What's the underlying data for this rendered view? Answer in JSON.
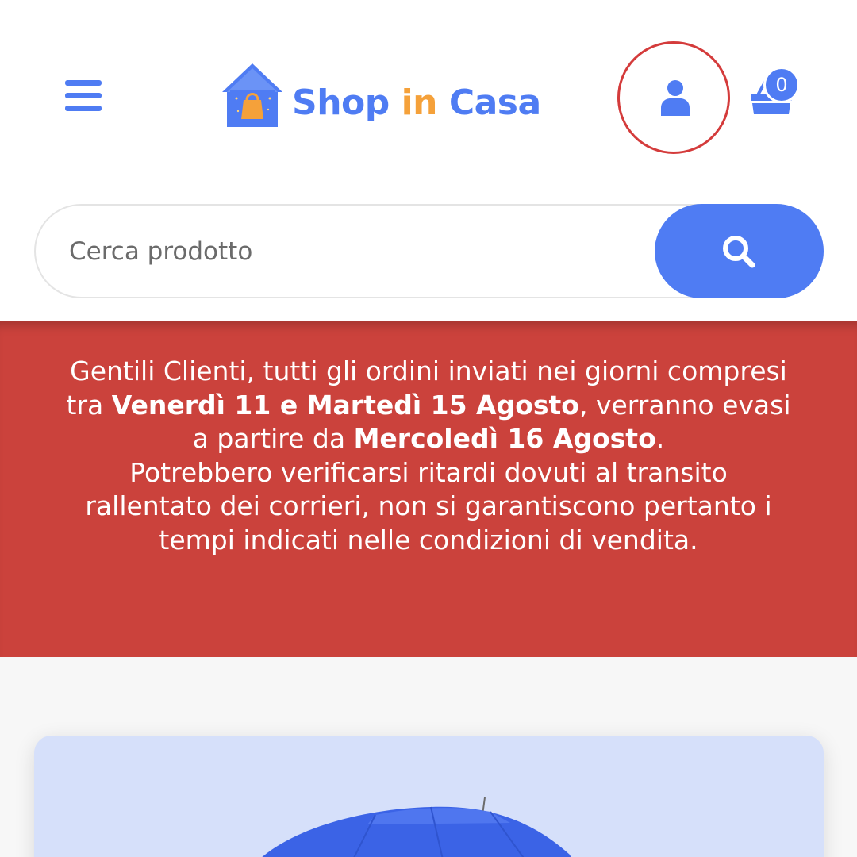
{
  "header": {
    "logo": {
      "word1": "Shop",
      "word2": "in",
      "word3": "Casa"
    },
    "menu_icon": "hamburger-menu-icon",
    "account_icon": "user-icon",
    "cart": {
      "icon": "shopping-basket-icon",
      "count": "0"
    }
  },
  "search": {
    "placeholder": "Cerca prodotto",
    "value": "",
    "icon": "search-icon"
  },
  "notice": {
    "line_a": "Gentili Clienti, tutti gli ordini inviati nei giorni compresi tra ",
    "bold_a": "Venerdì 11 e Martedì 15 Agosto",
    "line_b": ", verranno evasi a partire da ",
    "bold_b": "Mercoledì 16 Agosto",
    "line_c": ".",
    "line_d": "Potrebbero verificarsi ritardi dovuti al transito rallentato dei corrieri, non si garantiscono pertanto i tempi indicati nelle condizioni di vendita."
  },
  "colors": {
    "brand_blue": "#4f7cf3",
    "brand_orange": "#f5a13a",
    "notice_red": "#cb423c",
    "account_ring": "#d43b3b"
  }
}
